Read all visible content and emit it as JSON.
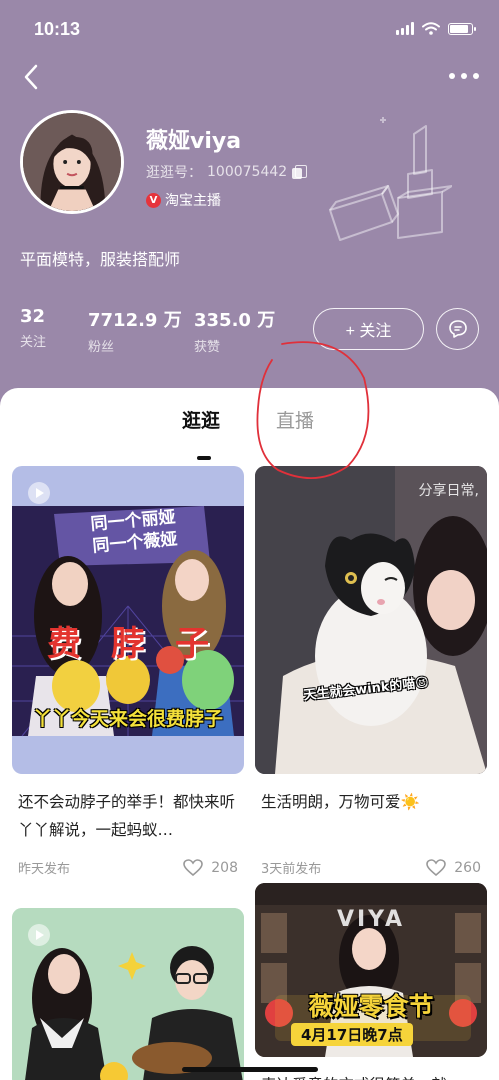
{
  "status_bar": {
    "time": "10:13"
  },
  "profile": {
    "name": "薇娅viya",
    "uid_label": "逛逛号：",
    "uid_value": "100075442",
    "badge_label": "淘宝主播",
    "bio": "平面模特，服装搭配师"
  },
  "stats": [
    {
      "value": "32",
      "label": "关注"
    },
    {
      "value": "7712.9 万",
      "label": "粉丝"
    },
    {
      "value": "335.0 万",
      "label": "获赞"
    }
  ],
  "follow_button": {
    "label": "+ 关注"
  },
  "tabs": [
    {
      "label": "逛逛",
      "active": true
    },
    {
      "label": "直播",
      "active": false
    }
  ],
  "cards": [
    {
      "title": "还不会动脖子的举手！都快来听丫丫解说，一起蚂蚁…",
      "meta": "昨天发布",
      "likes": "208",
      "overlay_text": "丫丫今天来会很费脖子",
      "thumb_caption_1": "费",
      "thumb_caption_2": "脖",
      "thumb_caption_3": "子",
      "banner_line1": "同一个丽娅",
      "banner_line2": "同一个薇娅"
    },
    {
      "title": "生活明朗，万物可爱☀️",
      "meta": "3天前发布",
      "likes": "260",
      "overlay_text": "分享日常,",
      "sticker_text": "天生就会wink的喵😉"
    },
    {
      "title": "",
      "meta": "",
      "likes": ""
    },
    {
      "title": "表达爱意的方式很简单，就",
      "meta": "",
      "likes": "",
      "overlay_top": "VIYA",
      "overlay_main": "薇娅零食节",
      "overlay_sub": "4月17日晚7点"
    }
  ],
  "colors": {
    "header_bg": "#9a88a9",
    "annotation": "#e0303a",
    "badge_red": "#e6343c",
    "text_primary": "#222222",
    "text_secondary": "#999999"
  }
}
